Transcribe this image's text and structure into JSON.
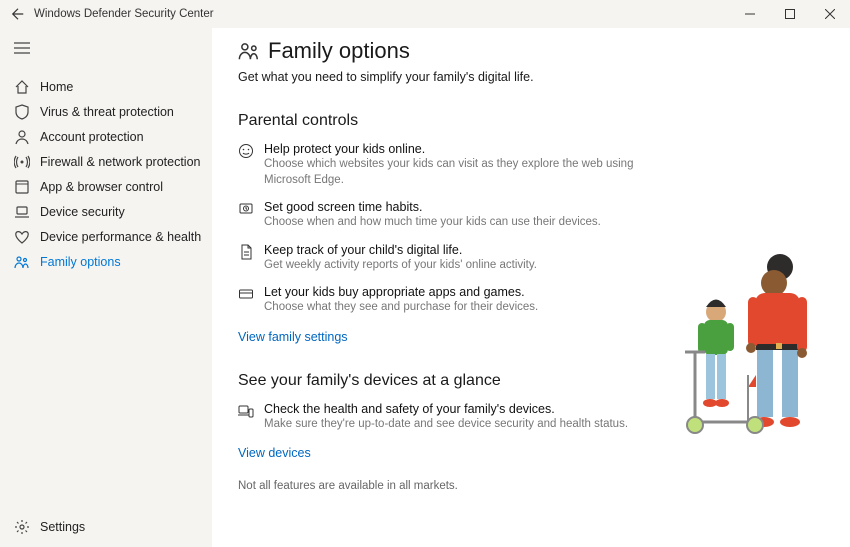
{
  "window": {
    "title": "Windows Defender Security Center"
  },
  "sidebar": {
    "items": [
      {
        "id": "home",
        "label": "Home"
      },
      {
        "id": "virus",
        "label": "Virus & threat protection"
      },
      {
        "id": "account",
        "label": "Account protection"
      },
      {
        "id": "firewall",
        "label": "Firewall & network protection"
      },
      {
        "id": "appbrowser",
        "label": "App & browser control"
      },
      {
        "id": "device",
        "label": "Device security"
      },
      {
        "id": "perf",
        "label": "Device performance & health"
      },
      {
        "id": "family",
        "label": "Family options"
      }
    ],
    "settings_label": "Settings"
  },
  "page": {
    "title": "Family options",
    "subtitle": "Get what you need to simplify your family's digital life."
  },
  "parental": {
    "heading": "Parental controls",
    "items": [
      {
        "title": "Help protect your kids online.",
        "desc": "Choose which websites your kids can visit as they explore the web using Microsoft Edge."
      },
      {
        "title": "Set good screen time habits.",
        "desc": "Choose when and how much time your kids can use their devices."
      },
      {
        "title": "Keep track of your child's digital life.",
        "desc": "Get weekly activity reports of your kids' online activity."
      },
      {
        "title": "Let your kids buy appropriate apps and games.",
        "desc": "Choose what they see and purchase for their devices."
      }
    ],
    "link": "View family settings"
  },
  "devices": {
    "heading": "See your family's devices at a glance",
    "items": [
      {
        "title": "Check the health and safety of your family's devices.",
        "desc": "Make sure they're up-to-date and see device security and health status."
      }
    ],
    "link": "View devices"
  },
  "disclaimer": "Not all features are available in all markets."
}
